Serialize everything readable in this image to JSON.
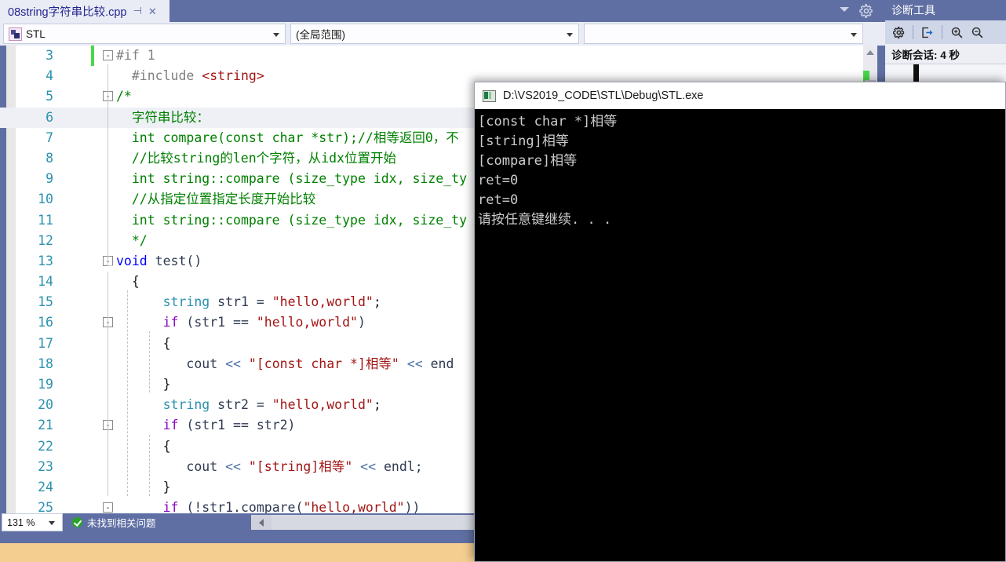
{
  "window": {
    "tab_title": "08string字符串比较.cpp",
    "pin_glyph": "⊣",
    "close_glyph": "✕"
  },
  "navbar": {
    "project": "STL",
    "scope": "(全局范围)",
    "member": ""
  },
  "editor": {
    "zoom_level": "131 %",
    "status_text": "未找到相关问题",
    "lines": [
      {
        "num": "3",
        "fold": "-",
        "change": true,
        "current": false,
        "tokens": [
          {
            "t": "#if 1",
            "c": "pp"
          }
        ]
      },
      {
        "num": "4",
        "fold": "",
        "change": false,
        "current": false,
        "tokens": [
          {
            "t": "  #include ",
            "c": "pp"
          },
          {
            "t": "<string>",
            "c": "hdr"
          }
        ]
      },
      {
        "num": "5",
        "fold": "-",
        "change": false,
        "current": false,
        "tokens": [
          {
            "t": "/*",
            "c": "cm"
          }
        ]
      },
      {
        "num": "6",
        "fold": "",
        "change": false,
        "current": true,
        "tokens": [
          {
            "t": "  字符串比较：",
            "c": "cm"
          }
        ]
      },
      {
        "num": "7",
        "fold": "",
        "change": false,
        "current": false,
        "tokens": [
          {
            "t": "  int compare(const char *str);//相等返回0，不",
            "c": "cm"
          }
        ]
      },
      {
        "num": "8",
        "fold": "",
        "change": false,
        "current": false,
        "tokens": [
          {
            "t": "  //比较string的len个字符，从idx位置开始",
            "c": "cm"
          }
        ]
      },
      {
        "num": "9",
        "fold": "",
        "change": false,
        "current": false,
        "tokens": [
          {
            "t": "  int string::compare (size_type idx, size_ty",
            "c": "cm"
          }
        ]
      },
      {
        "num": "10",
        "fold": "",
        "change": false,
        "current": false,
        "tokens": [
          {
            "t": "  //从指定位置指定长度开始比较",
            "c": "cm"
          }
        ]
      },
      {
        "num": "11",
        "fold": "",
        "change": false,
        "current": false,
        "tokens": [
          {
            "t": "  int string::compare (size_type idx, size_ty",
            "c": "cm"
          }
        ]
      },
      {
        "num": "12",
        "fold": "",
        "change": false,
        "current": false,
        "tokens": [
          {
            "t": "  */",
            "c": "cm"
          }
        ]
      },
      {
        "num": "13",
        "fold": "-",
        "change": false,
        "current": false,
        "tokens": [
          {
            "t": "void",
            "c": "k"
          },
          {
            "t": " test()",
            "c": "id"
          }
        ]
      },
      {
        "num": "14",
        "fold": "",
        "change": false,
        "current": false,
        "tokens": [
          {
            "t": "  {",
            "c": "pl"
          }
        ]
      },
      {
        "num": "15",
        "fold": "",
        "change": false,
        "current": false,
        "tokens": [
          {
            "t": "      ",
            "c": "pl"
          },
          {
            "t": "string",
            "c": "ty"
          },
          {
            "t": " str1 = ",
            "c": "id"
          },
          {
            "t": "\"hello,world\"",
            "c": "str"
          },
          {
            "t": ";",
            "c": "pl"
          }
        ]
      },
      {
        "num": "16",
        "fold": "-",
        "change": false,
        "current": false,
        "tokens": [
          {
            "t": "      ",
            "c": "pl"
          },
          {
            "t": "if",
            "c": "kf"
          },
          {
            "t": " (str1 == ",
            "c": "id"
          },
          {
            "t": "\"hello,world\"",
            "c": "str"
          },
          {
            "t": ")",
            "c": "id"
          }
        ]
      },
      {
        "num": "17",
        "fold": "",
        "change": false,
        "current": false,
        "tokens": [
          {
            "t": "      {",
            "c": "pl"
          }
        ]
      },
      {
        "num": "18",
        "fold": "",
        "change": false,
        "current": false,
        "tokens": [
          {
            "t": "         cout ",
            "c": "id"
          },
          {
            "t": "<<",
            "c": "op"
          },
          {
            "t": " ",
            "c": "pl"
          },
          {
            "t": "\"[const char *]相等\"",
            "c": "str"
          },
          {
            "t": " ",
            "c": "pl"
          },
          {
            "t": "<<",
            "c": "op"
          },
          {
            "t": " end",
            "c": "id"
          }
        ]
      },
      {
        "num": "19",
        "fold": "",
        "change": false,
        "current": false,
        "tokens": [
          {
            "t": "      }",
            "c": "pl"
          }
        ]
      },
      {
        "num": "20",
        "fold": "",
        "change": false,
        "current": false,
        "tokens": [
          {
            "t": "      ",
            "c": "pl"
          },
          {
            "t": "string",
            "c": "ty"
          },
          {
            "t": " str2 = ",
            "c": "id"
          },
          {
            "t": "\"hello,world\"",
            "c": "str"
          },
          {
            "t": ";",
            "c": "pl"
          }
        ]
      },
      {
        "num": "21",
        "fold": "-",
        "change": false,
        "current": false,
        "tokens": [
          {
            "t": "      ",
            "c": "pl"
          },
          {
            "t": "if",
            "c": "kf"
          },
          {
            "t": " (str1 == str2)",
            "c": "id"
          }
        ]
      },
      {
        "num": "22",
        "fold": "",
        "change": false,
        "current": false,
        "tokens": [
          {
            "t": "      {",
            "c": "pl"
          }
        ]
      },
      {
        "num": "23",
        "fold": "",
        "change": false,
        "current": false,
        "tokens": [
          {
            "t": "         cout ",
            "c": "id"
          },
          {
            "t": "<<",
            "c": "op"
          },
          {
            "t": " ",
            "c": "pl"
          },
          {
            "t": "\"[string]相等\"",
            "c": "str"
          },
          {
            "t": " ",
            "c": "pl"
          },
          {
            "t": "<<",
            "c": "op"
          },
          {
            "t": " endl;",
            "c": "id"
          }
        ]
      },
      {
        "num": "24",
        "fold": "",
        "change": false,
        "current": false,
        "tokens": [
          {
            "t": "      }",
            "c": "pl"
          }
        ]
      },
      {
        "num": "25",
        "fold": "-",
        "change": false,
        "current": false,
        "tokens": [
          {
            "t": "      ",
            "c": "pl"
          },
          {
            "t": "if",
            "c": "kf"
          },
          {
            "t": " (!str1.compare(",
            "c": "id"
          },
          {
            "t": "\"hello,world\"",
            "c": "str"
          },
          {
            "t": "))",
            "c": "id"
          }
        ]
      }
    ]
  },
  "diagnostics": {
    "title": "诊断工具",
    "session_label": "诊断会话: 4 秒"
  },
  "console": {
    "title": "D:\\VS2019_CODE\\STL\\Debug\\STL.exe",
    "output": "[const char *]相等\n[string]相等\n[compare]相等\nret=0\nret=0\n请按任意键继续. . ."
  },
  "colors": {
    "vs_chrome": "#5f6fa3",
    "debug_bar": "#f3ce90",
    "accent_blue": "#2b91af",
    "comment_green": "#008000",
    "string_red": "#a31515"
  }
}
